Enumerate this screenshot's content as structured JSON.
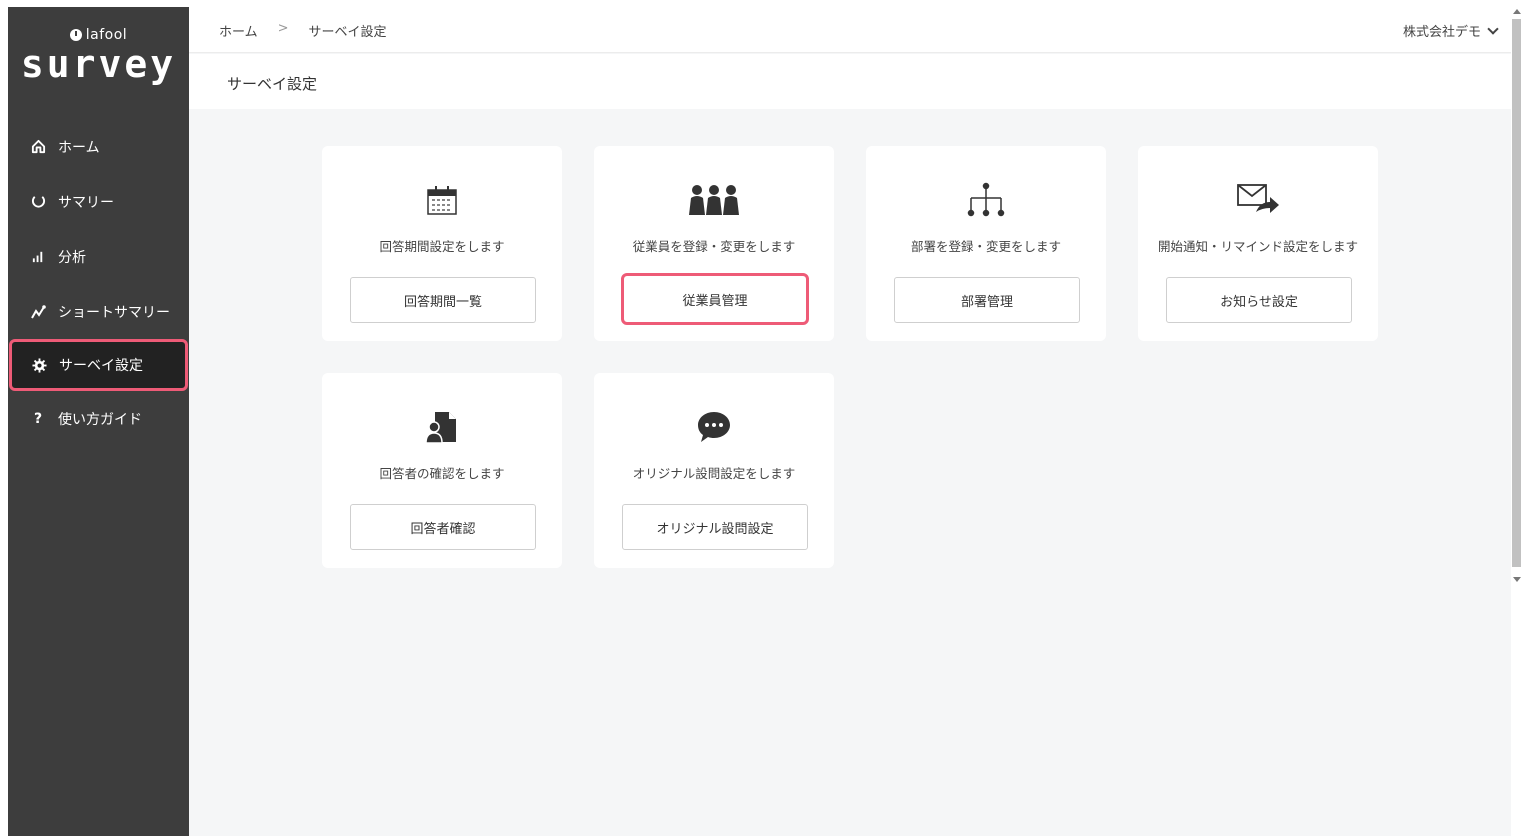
{
  "brand": {
    "small": "lafool",
    "big": "survey"
  },
  "sidebar": {
    "items": [
      {
        "label": "ホーム",
        "icon": "home-icon"
      },
      {
        "label": "サマリー",
        "icon": "loop-icon"
      },
      {
        "label": "分析",
        "icon": "bars-icon"
      },
      {
        "label": "ショートサマリー",
        "icon": "trend-icon"
      },
      {
        "label": "サーベイ設定",
        "icon": "gear-icon",
        "active": true
      },
      {
        "label": "使い方ガイド",
        "icon": "question-icon"
      }
    ]
  },
  "header": {
    "breadcrumb": {
      "home": "ホーム",
      "separator": ">",
      "current": "サーベイ設定"
    },
    "company": "株式会社デモ"
  },
  "page": {
    "title": "サーベイ設定"
  },
  "cards": [
    {
      "icon": "calendar-icon",
      "description": "回答期間設定をします",
      "button": "回答期間一覧"
    },
    {
      "icon": "people-icon",
      "description": "従業員を登録・変更をします",
      "button": "従業員管理",
      "highlighted": true
    },
    {
      "icon": "org-chart-icon",
      "description": "部署を登録・変更をします",
      "button": "部署管理"
    },
    {
      "icon": "mail-forward-icon",
      "description": "開始通知・リマインド設定をします",
      "button": "お知らせ設定"
    },
    {
      "icon": "respondent-doc-icon",
      "description": "回答者の確認をします",
      "button": "回答者確認"
    },
    {
      "icon": "chat-bubble-icon",
      "description": "オリジナル設問設定をします",
      "button": "オリジナル設問設定"
    }
  ],
  "colors": {
    "sidebar_bg": "#3d3d3d",
    "highlight": "#ee5b77",
    "content_bg": "#f5f6f7"
  }
}
